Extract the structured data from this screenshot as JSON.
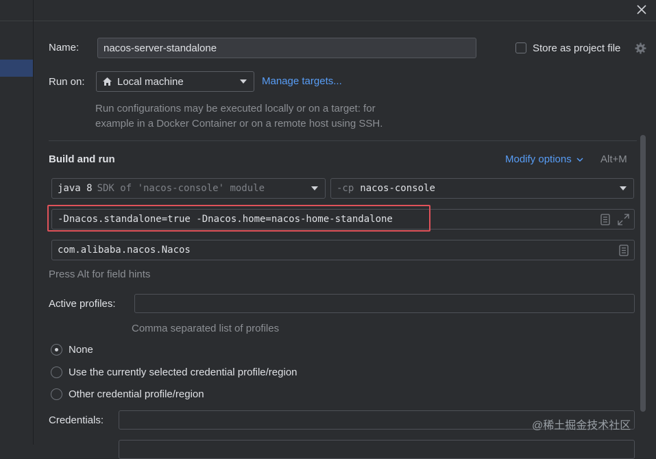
{
  "dialog": {
    "close_icon": "close-icon"
  },
  "name_row": {
    "label": "Name:",
    "value": "nacos-server-standalone"
  },
  "store_project_file": {
    "label": "Store as project file",
    "checked": false,
    "gear_icon": "gear-icon"
  },
  "run_on": {
    "label": "Run on:",
    "target_value": "Local machine",
    "target_icon": "home-icon",
    "manage_link": "Manage targets...",
    "hint_line1": "Run configurations may be executed locally or on a target: for",
    "hint_line2": "example in a Docker Container or on a remote host using SSH."
  },
  "build_and_run": {
    "section_title": "Build and run",
    "modify_options": "Modify options",
    "modify_shortcut": "Alt+M",
    "jdk_prefix": "java 8",
    "jdk_suffix": "SDK of 'nacos-console' module",
    "cp_prefix": "-cp",
    "cp_value": "nacos-console",
    "vm_options": "-Dnacos.standalone=true -Dnacos.home=nacos-home-standalone",
    "main_class": "com.alibaba.nacos.Nacos",
    "field_hint": "Press Alt for field hints"
  },
  "profiles": {
    "label": "Active profiles:",
    "value": "",
    "hint": "Comma separated list of profiles"
  },
  "credentials_options": [
    {
      "label": "None",
      "checked": true
    },
    {
      "label": "Use the currently selected credential profile/region",
      "checked": false
    },
    {
      "label": "Other credential profile/region",
      "checked": false
    }
  ],
  "credentials": {
    "label": "Credentials:",
    "value": ""
  },
  "watermark": "@稀土掘金技术社区",
  "colors": {
    "background": "#2b2d30",
    "accent_link": "#589df6",
    "highlight_red": "#e0525a",
    "selection": "#2e436e"
  }
}
